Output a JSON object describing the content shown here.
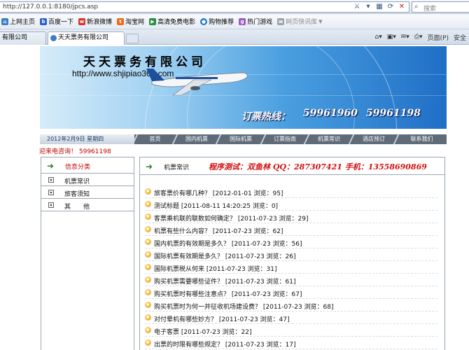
{
  "browser": {
    "address": "http://127.0.0.1:8180/jpcs.asp",
    "search_placeholder": "搜索",
    "favorites": [
      {
        "label": "上网主页",
        "color": "#3d7fc4"
      },
      {
        "label": "百度一下",
        "color": "#2c5fd1"
      },
      {
        "label": "新浪微博",
        "color": "#d9342b"
      },
      {
        "label": "淘宝网",
        "color": "#f06a18"
      },
      {
        "label": "高清免费电影",
        "color": "#2a8d3c"
      },
      {
        "label": "购物推荐",
        "color": "#1e78c8"
      },
      {
        "label": "热门游戏",
        "color": "#9a5bc2"
      },
      {
        "label": "网页快讯库",
        "color": "#9aa4b0"
      }
    ],
    "tabs": [
      "有限公司",
      "天天票务有限公司"
    ],
    "commands": {
      "page": "页面(P)",
      "safety": "安全"
    }
  },
  "site": {
    "company_name": "天天票务有限公司",
    "url": "http://www.shjipiao365.com",
    "hotline_label": "订票热线：",
    "hotline_numbers": [
      "59961960",
      "59961198"
    ],
    "date": "2012年2月9日  星期四",
    "nav": [
      "首页",
      "国内机票",
      "国际机票",
      "订票指南",
      "机票常识",
      "酒店预订",
      "联系我们"
    ],
    "marquee": "迎来电咨询！ 59961198"
  },
  "sidebar": {
    "title": "信息分类",
    "items": [
      "机票常识",
      "旅客须知",
      "其　　他"
    ]
  },
  "main": {
    "title": "机票常识",
    "promo": "程序测试：双鱼林   QQ：287307421   手机：13558690869",
    "news": [
      "旅客票价有哪几种？ [2012-01-01  浏览：95]",
      "测试标题 [2011-08-11 14:20:25  浏览：0]",
      "客票乘机联的联数如何确定？ [2011-07-23  浏览：29]",
      "机票有些什么内容？ [2011-07-23  浏览：62]",
      "国内机票的有效期是多久？ [2011-07-23  浏览：56]",
      "国际机票有效期是多久？ [2011-07-23  浏览：26]",
      "国际机票税从何来 [2011-07-23  浏览：31]",
      "购买机票需要哪些证件？ [2011-07-23  浏览：61]",
      "购买机票时有哪些注意点？ [2011-07-23  浏览：67]",
      "购买机票时为何一并征收机场建设费？ [2011-07-23  浏览：68]",
      "对付晕机有哪些妙方？ [2011-07-23  浏览：47]",
      "电子客票 [2011-07-23  浏览：22]",
      "出票的时限有哪些规定？ [2011-07-23  浏览：17]"
    ]
  }
}
